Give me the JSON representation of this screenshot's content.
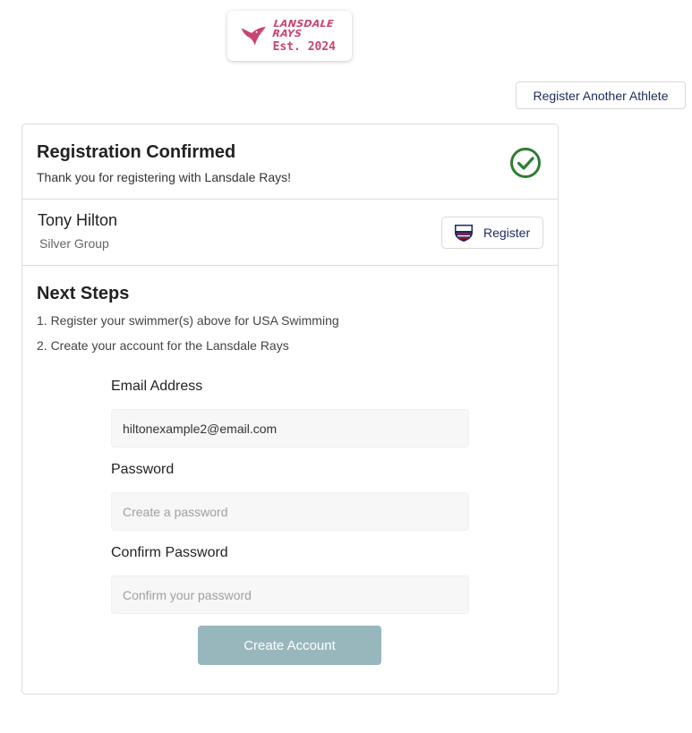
{
  "logo": {
    "name": "LANSDALE RAYS",
    "est": "Est. 2024",
    "icon": "stingray-icon",
    "brand_color": "#c8456e"
  },
  "register_another_label": "Register Another Athlete",
  "confirmation": {
    "title": "Registration Confirmed",
    "subtitle": "Thank you for registering with Lansdale Rays!",
    "icon": "check-circle-icon",
    "icon_color": "#2e7d32"
  },
  "athlete": {
    "name": "Tony Hilton",
    "group": "Silver Group",
    "register_label": "Register",
    "register_icon": "usa-swimming-logo-icon"
  },
  "next_steps": {
    "title": "Next Steps",
    "items": [
      "1. Register your swimmer(s) above for USA Swimming",
      "2. Create your account for the Lansdale Rays"
    ]
  },
  "form": {
    "email_label": "Email Address",
    "email_value": "hiltonexample2@email.com",
    "password_label": "Password",
    "password_placeholder": "Create a password",
    "confirm_label": "Confirm Password",
    "confirm_placeholder": "Confirm your password",
    "submit_label": "Create Account",
    "submit_color": "#98b7bd"
  }
}
